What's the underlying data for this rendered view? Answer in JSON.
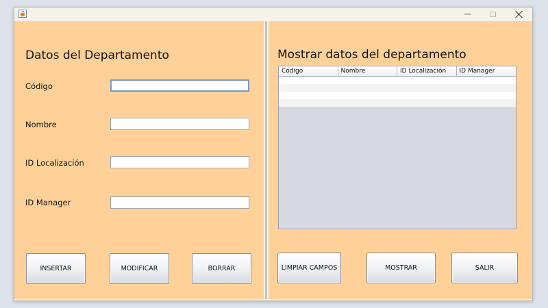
{
  "window": {
    "title": "",
    "icon": "java-icon",
    "controls": [
      "minimize-icon",
      "maximize-icon",
      "close-icon"
    ]
  },
  "left_panel": {
    "title": "Datos del Departamento",
    "fields": [
      {
        "label": "Código",
        "value": "",
        "focused": true
      },
      {
        "label": "Nombre",
        "value": ""
      },
      {
        "label": "ID Localización",
        "value": ""
      },
      {
        "label": "ID Manager",
        "value": ""
      }
    ],
    "buttons": {
      "insert": "INSERTAR",
      "modify": "MODIFICAR",
      "delete": "BORRAR"
    }
  },
  "right_panel": {
    "title": "Mostrar datos del departamento",
    "table": {
      "columns": [
        "Código",
        "Nombre",
        "ID Localización",
        "ID Manager"
      ],
      "rows": [
        [
          "",
          "",
          "",
          ""
        ],
        [
          "",
          "",
          "",
          ""
        ],
        [
          "",
          "",
          "",
          ""
        ],
        [
          "",
          "",
          "",
          ""
        ]
      ]
    },
    "buttons": {
      "clear": "LIMPIAR CAMPOS",
      "show": "MOSTRAR",
      "exit": "SALIR"
    }
  },
  "colors": {
    "panel_background": "#ffd199",
    "table_empty_area": "#d6d9e0",
    "focus_border": "#7a98c6"
  }
}
